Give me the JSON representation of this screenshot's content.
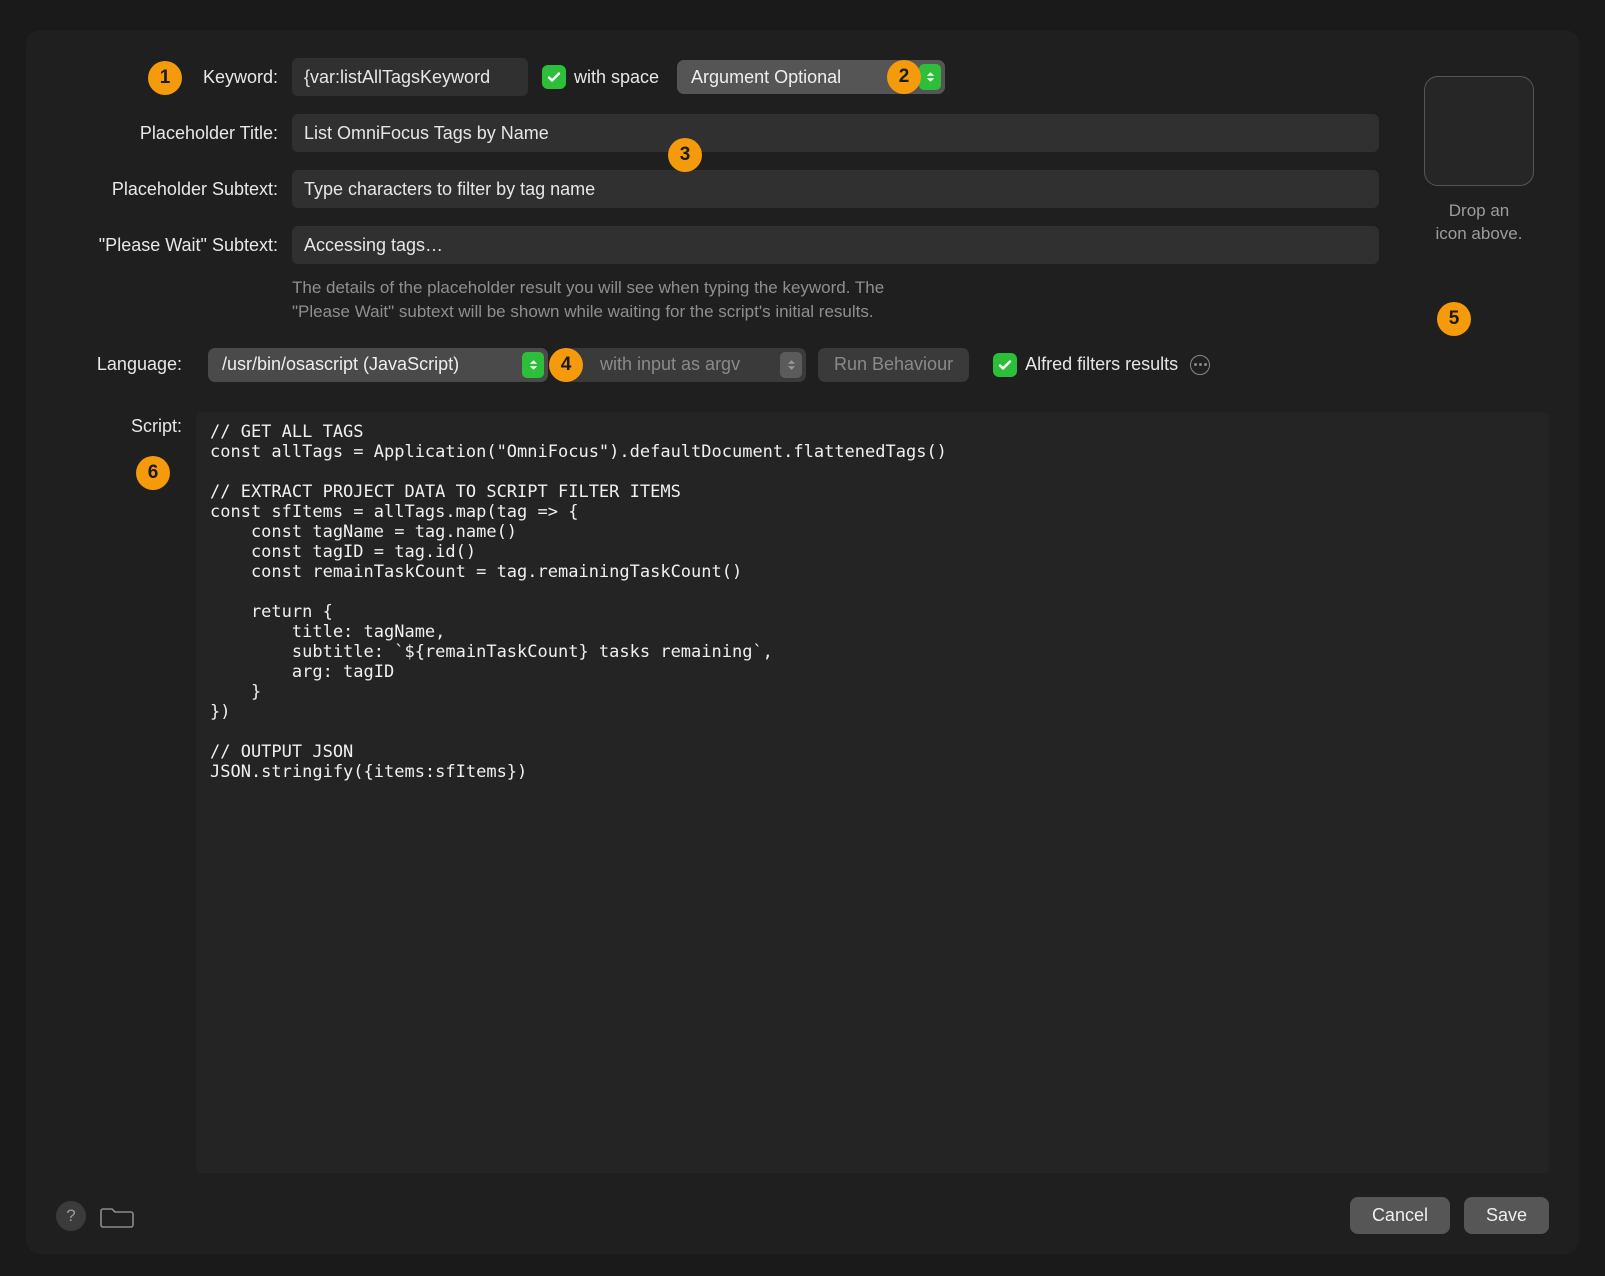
{
  "labels": {
    "keyword": "Keyword:",
    "placeholder_title": "Placeholder Title:",
    "placeholder_subtext": "Placeholder Subtext:",
    "please_wait_subtext": "\"Please Wait\" Subtext:",
    "language": "Language:",
    "script": "Script:"
  },
  "fields": {
    "keyword_value": "{var:listAllTagsKeyword",
    "with_space_label": "with space",
    "argument_mode": "Argument Optional",
    "placeholder_title_value": "List OmniFocus Tags by Name",
    "placeholder_subtext_value": "Type characters to filter by tag name",
    "please_wait_value": "Accessing tags…"
  },
  "help_text": "The details of the placeholder result you will see when typing the keyword. The \"Please Wait\" subtext will be shown while waiting for the script's initial results.",
  "icon_drop": {
    "line1": "Drop an",
    "line2": "icon above."
  },
  "language_row": {
    "language_value": "/usr/bin/osascript (JavaScript)",
    "input_mode": "with input as argv",
    "run_behaviour": "Run Behaviour",
    "filters_label": "Alfred filters results"
  },
  "script_code": "// GET ALL TAGS\nconst allTags = Application(\"OmniFocus\").defaultDocument.flattenedTags()\n\n// EXTRACT PROJECT DATA TO SCRIPT FILTER ITEMS\nconst sfItems = allTags.map(tag => {\n    const tagName = tag.name()\n    const tagID = tag.id()\n    const remainTaskCount = tag.remainingTaskCount()\n\n    return {\n        title: tagName,\n        subtitle: `${remainTaskCount} tasks remaining`,\n        arg: tagID\n    }\n})\n\n// OUTPUT JSON\nJSON.stringify({items:sfItems})",
  "buttons": {
    "cancel": "Cancel",
    "save": "Save"
  },
  "badges": {
    "b1": "1",
    "b2": "2",
    "b3": "3",
    "b4": "4",
    "b5": "5",
    "b6": "6"
  }
}
